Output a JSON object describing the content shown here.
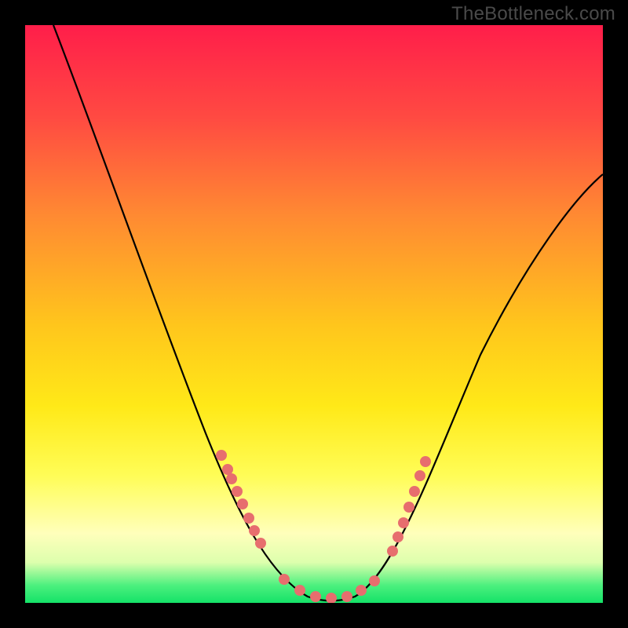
{
  "attribution": "TheBottleneck.com",
  "colors": {
    "frame": "#000000",
    "curve": "#000000",
    "marker": "#e76e6e",
    "gradient_top": "#ff1e4a",
    "gradient_bottom": "#14e268"
  },
  "chart_data": {
    "type": "line",
    "title": "",
    "xlabel": "",
    "ylabel": "",
    "xlim": [
      0,
      100
    ],
    "ylim": [
      0,
      100
    ],
    "x": [
      5,
      10,
      15,
      20,
      25,
      30,
      35,
      40,
      45,
      48,
      50,
      52,
      55,
      60,
      65,
      70,
      75,
      80,
      85,
      90,
      95,
      100
    ],
    "y": [
      100,
      87,
      74,
      61,
      48,
      36,
      26,
      17,
      9,
      5,
      3,
      2,
      1,
      3,
      8,
      15,
      23,
      32,
      41,
      50,
      58,
      65
    ],
    "markers": {
      "left_cluster": {
        "x": [
          35,
          36,
          37,
          38,
          39,
          40,
          41,
          42
        ],
        "y": [
          24,
          22,
          20,
          18,
          16,
          14,
          12,
          10
        ]
      },
      "bottom_cluster": {
        "x": [
          46,
          48,
          50,
          52,
          54,
          56,
          58
        ],
        "y": [
          4,
          2,
          1.5,
          1,
          1.5,
          2,
          3
        ]
      },
      "right_cluster": {
        "x": [
          60,
          61,
          62,
          63,
          64,
          65,
          66
        ],
        "y": [
          9,
          11,
          13,
          16,
          19,
          22,
          25
        ]
      }
    }
  }
}
